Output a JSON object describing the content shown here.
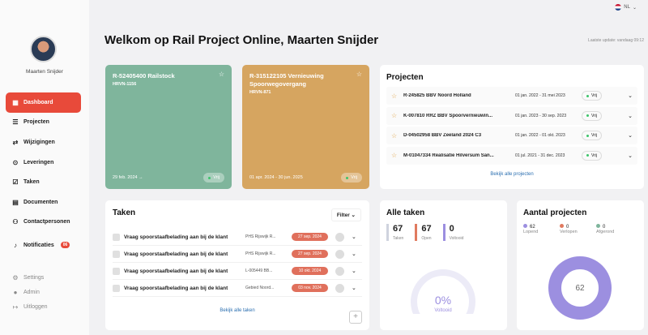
{
  "lang": "NL",
  "user": {
    "name": "Maarten Snijder"
  },
  "title": "Welkom op Rail Project Online, Maarten Snijder",
  "last_update": "Laatste update: vandaag 09:12",
  "nav": [
    {
      "label": "Dashboard",
      "icon": "grid-icon"
    },
    {
      "label": "Projecten",
      "icon": "list-icon"
    },
    {
      "label": "Wijzigingen",
      "icon": "swap-icon"
    },
    {
      "label": "Leveringen",
      "icon": "pin-icon"
    },
    {
      "label": "Taken",
      "icon": "checklist-icon"
    },
    {
      "label": "Documenten",
      "icon": "document-icon"
    },
    {
      "label": "Contactpersonen",
      "icon": "people-icon"
    },
    {
      "label": "Notificaties",
      "icon": "bell-icon",
      "badge": "06"
    }
  ],
  "nav_bottom": [
    "Settings",
    "Admin",
    "Uitloggen"
  ],
  "cards": [
    {
      "title": "R-52405400 Railstock",
      "code": "HRVN-1156",
      "date": "29 feb. 2024 →",
      "status": "Vrij"
    },
    {
      "title": "R-315122105 Vernieuwing Spoorwegovergang",
      "code": "HRVN-871",
      "date": "01 apr. 2024 - 30 jun. 2025",
      "status": "Vrij"
    }
  ],
  "projecten": {
    "title": "Projecten",
    "rows": [
      {
        "name": "R-245825 BBV Noord Holland",
        "dates": "01 jan. 2022 - 31 mei 2023",
        "status": "Vrij"
      },
      {
        "name": "K-007810 RRZ BBV Spoorvernieuwin...",
        "dates": "01 jan. 2023 - 30 sep. 2023",
        "status": "Vrij"
      },
      {
        "name": "D-04502958 BBV Zeeland 2024 C3",
        "dates": "01 jan. 2022 - 01 okt. 2023",
        "status": "Vrij"
      },
      {
        "name": "M-01047334 Realisatie Hilversum San...",
        "dates": "01 jul. 2021 - 31 dec. 2023",
        "status": "Vrij"
      }
    ],
    "link": "Bekijk alle projecten"
  },
  "taken": {
    "title": "Taken",
    "filter": "Filter",
    "rows": [
      {
        "name": "Vraag spoorstaafbelading aan bij de klant",
        "loc": "PHS Rijswijk R...",
        "date": "27 sep. 2024"
      },
      {
        "name": "Vraag spoorstaafbelading aan bij de klant",
        "loc": "PHS Rijswijk R...",
        "date": "27 sep. 2024"
      },
      {
        "name": "Vraag spoorstaafbelading aan bij de klant",
        "loc": "L-005449 BB...",
        "date": "10 okt. 2024"
      },
      {
        "name": "Vraag spoorstaafbelading aan bij de klant",
        "loc": "Gebied Noord...",
        "date": "03 nov. 2024"
      }
    ],
    "link": "Bekijk alle taken"
  },
  "alle_taken": {
    "title": "Alle taken",
    "stats": [
      {
        "value": "67",
        "label": "Taken",
        "color": "#cfd3de"
      },
      {
        "value": "67",
        "label": "Open",
        "color": "#e07a5f"
      },
      {
        "value": "0",
        "label": "Voltooid",
        "color": "#9c8fe0"
      }
    ],
    "percent": "0%",
    "percent_label": "Voltooid",
    "progress": 0
  },
  "aantal": {
    "title": "Aantal projecten",
    "legend": [
      {
        "value": "62",
        "label": "Lopend",
        "color": "#9c8fe0"
      },
      {
        "value": "0",
        "label": "Verlopen",
        "color": "#e07a5f"
      },
      {
        "value": "0",
        "label": "Afgerond",
        "color": "#7fb59c"
      }
    ],
    "total": "62"
  }
}
